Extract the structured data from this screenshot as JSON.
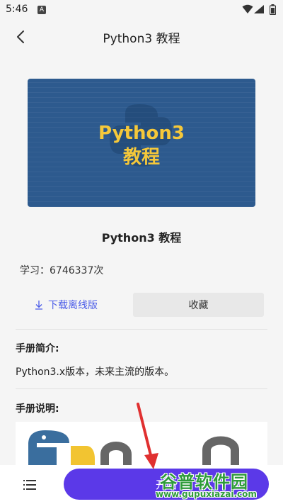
{
  "status_bar": {
    "time": "5:46",
    "notification_icon": "A"
  },
  "header": {
    "title": "Python3 教程",
    "back_icon": "chevron-left-icon"
  },
  "banner": {
    "line1": "Python3",
    "line2": "教程"
  },
  "course": {
    "title": "Python3 教程",
    "learn_count": "学习：6746337次",
    "download_label": "下载离线版",
    "favorite_label": "收藏"
  },
  "intro": {
    "heading": "手册简介:",
    "text": "Python3.x版本，未来主流的版本。"
  },
  "notes": {
    "heading": "手册说明:"
  },
  "bottom": {
    "start_label": "开始",
    "menu_icon": "list-icon"
  },
  "watermark": {
    "title": "谷普软件园",
    "url": "www.gupuxiazai.com"
  },
  "colors": {
    "accent": "#5b39e8",
    "link": "#4a5be8",
    "banner_bg": "#2d5a8e",
    "banner_text": "#f5c83a",
    "annotation": "#e03030",
    "watermark": "#2e9b3a"
  }
}
